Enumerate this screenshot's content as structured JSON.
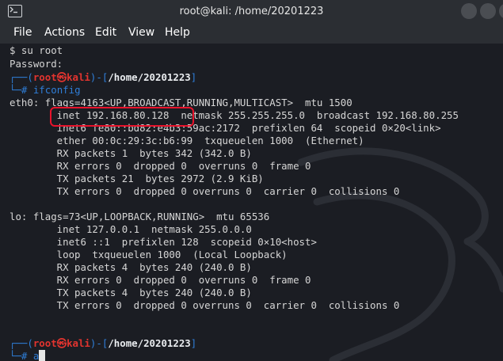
{
  "window": {
    "title": "root@kali: /home/20201223"
  },
  "menu": [
    "File",
    "Actions",
    "Edit",
    "View",
    "Help"
  ],
  "terminal": {
    "lines": [
      "$ su root",
      "Password:",
      "eth0: flags=4163<UP,BROADCAST,RUNNING,MULTICAST>  mtu 1500",
      "        inet 192.168.80.128  netmask 255.255.255.0  broadcast 192.168.80.255",
      "        inet6 fe80::bd82:e4b3:59ac:2172  prefixlen 64  scopeid 0×20<link>",
      "        ether 00:0c:29:3c:b6:99  txqueuelen 1000  (Ethernet)",
      "        RX packets 1  bytes 342 (342.0 B)",
      "        RX errors 0  dropped 0  overruns 0  frame 0",
      "        TX packets 21  bytes 2972 (2.9 KiB)",
      "        TX errors 0  dropped 0 overruns 0  carrier 0  collisions 0",
      "lo: flags=73<UP,LOOPBACK,RUNNING>  mtu 65536",
      "        inet 127.0.0.1  netmask 255.0.0.0",
      "        inet6 ::1  prefixlen 128  scopeid 0×10<host>",
      "        loop  txqueuelen 1000  (Local Loopback)",
      "        RX packets 4  bytes 240 (240.0 B)",
      "        RX errors 0  dropped 0  overruns 0  frame 0",
      "        TX packets 4  bytes 240 (240.0 B)",
      "        TX errors 0  dropped 0 overruns 0  carrier 0  collisions 0"
    ],
    "prompt1": {
      "corner": "┌──(",
      "user": "root",
      "skull": "㉿",
      "host": "kali",
      "mid": ")-[",
      "path": "/home/20201223",
      "close": "]",
      "hash": "└─#",
      "command": " ifconfig"
    },
    "prompt2": {
      "corner": "┌──(",
      "user": "root",
      "skull": "㉿",
      "host": "kali",
      "mid": ")-[",
      "path": "/home/20201223",
      "close": "]",
      "hash": "└─#",
      "command": " a"
    }
  },
  "colors": {
    "prompt_blue": "#2f7ed8",
    "prompt_red": "#e3342f",
    "highlight_box": "#e8132b"
  }
}
